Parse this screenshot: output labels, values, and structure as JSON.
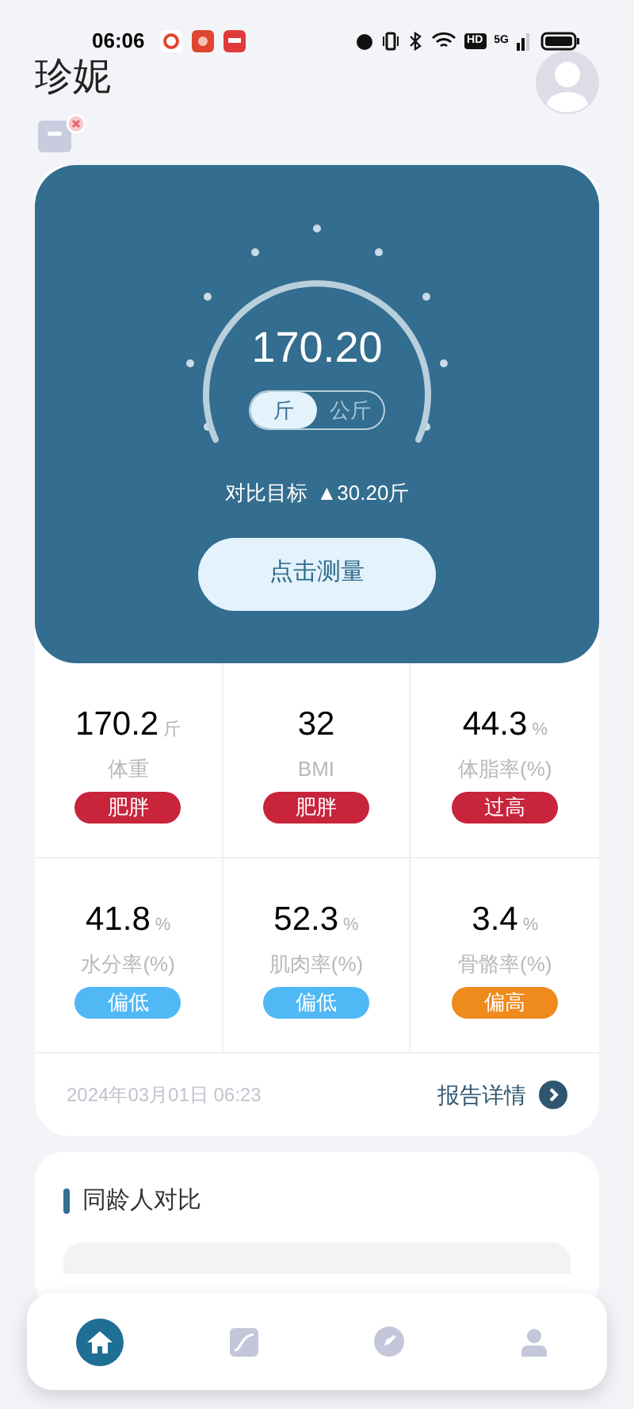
{
  "status_bar": {
    "time": "06:06",
    "hd": "HD",
    "network": "5G"
  },
  "user": {
    "name": "珍妮"
  },
  "scale": {
    "reading": "170.20",
    "units": [
      {
        "label": "斤",
        "selected": true
      },
      {
        "label": "公斤",
        "selected": false
      }
    ],
    "target_label": "对比目标",
    "target_delta": "▲30.20斤",
    "measure_button": "点击测量"
  },
  "metrics": [
    {
      "value": "170.2",
      "unit": "斤",
      "label": "体重",
      "status": "肥胖",
      "color": "#c8243c"
    },
    {
      "value": "32",
      "label": "BMI",
      "status": "肥胖",
      "color": "#c8243c"
    },
    {
      "value": "44.3",
      "unit": "%",
      "label": "体脂率(%)",
      "status": "过高",
      "color": "#c8243c"
    },
    {
      "value": "41.8",
      "unit": "%",
      "label": "水分率(%)",
      "status": "偏低",
      "color": "#4fb8f5"
    },
    {
      "value": "52.3",
      "unit": "%",
      "label": "肌肉率(%)",
      "status": "偏低",
      "color": "#4fb8f5"
    },
    {
      "value": "3.4",
      "unit": "%",
      "label": "骨骼率(%)",
      "status": "偏高",
      "color": "#ef8a1c"
    }
  ],
  "report": {
    "date": "2024年03月01日 06:23",
    "link": "报告详情"
  },
  "peer_section": {
    "title": "同龄人对比"
  },
  "nav": [
    {
      "kind": "home",
      "selected": true
    },
    {
      "kind": "trend",
      "selected": false
    },
    {
      "kind": "explore",
      "selected": false
    },
    {
      "kind": "profile",
      "selected": false
    }
  ]
}
